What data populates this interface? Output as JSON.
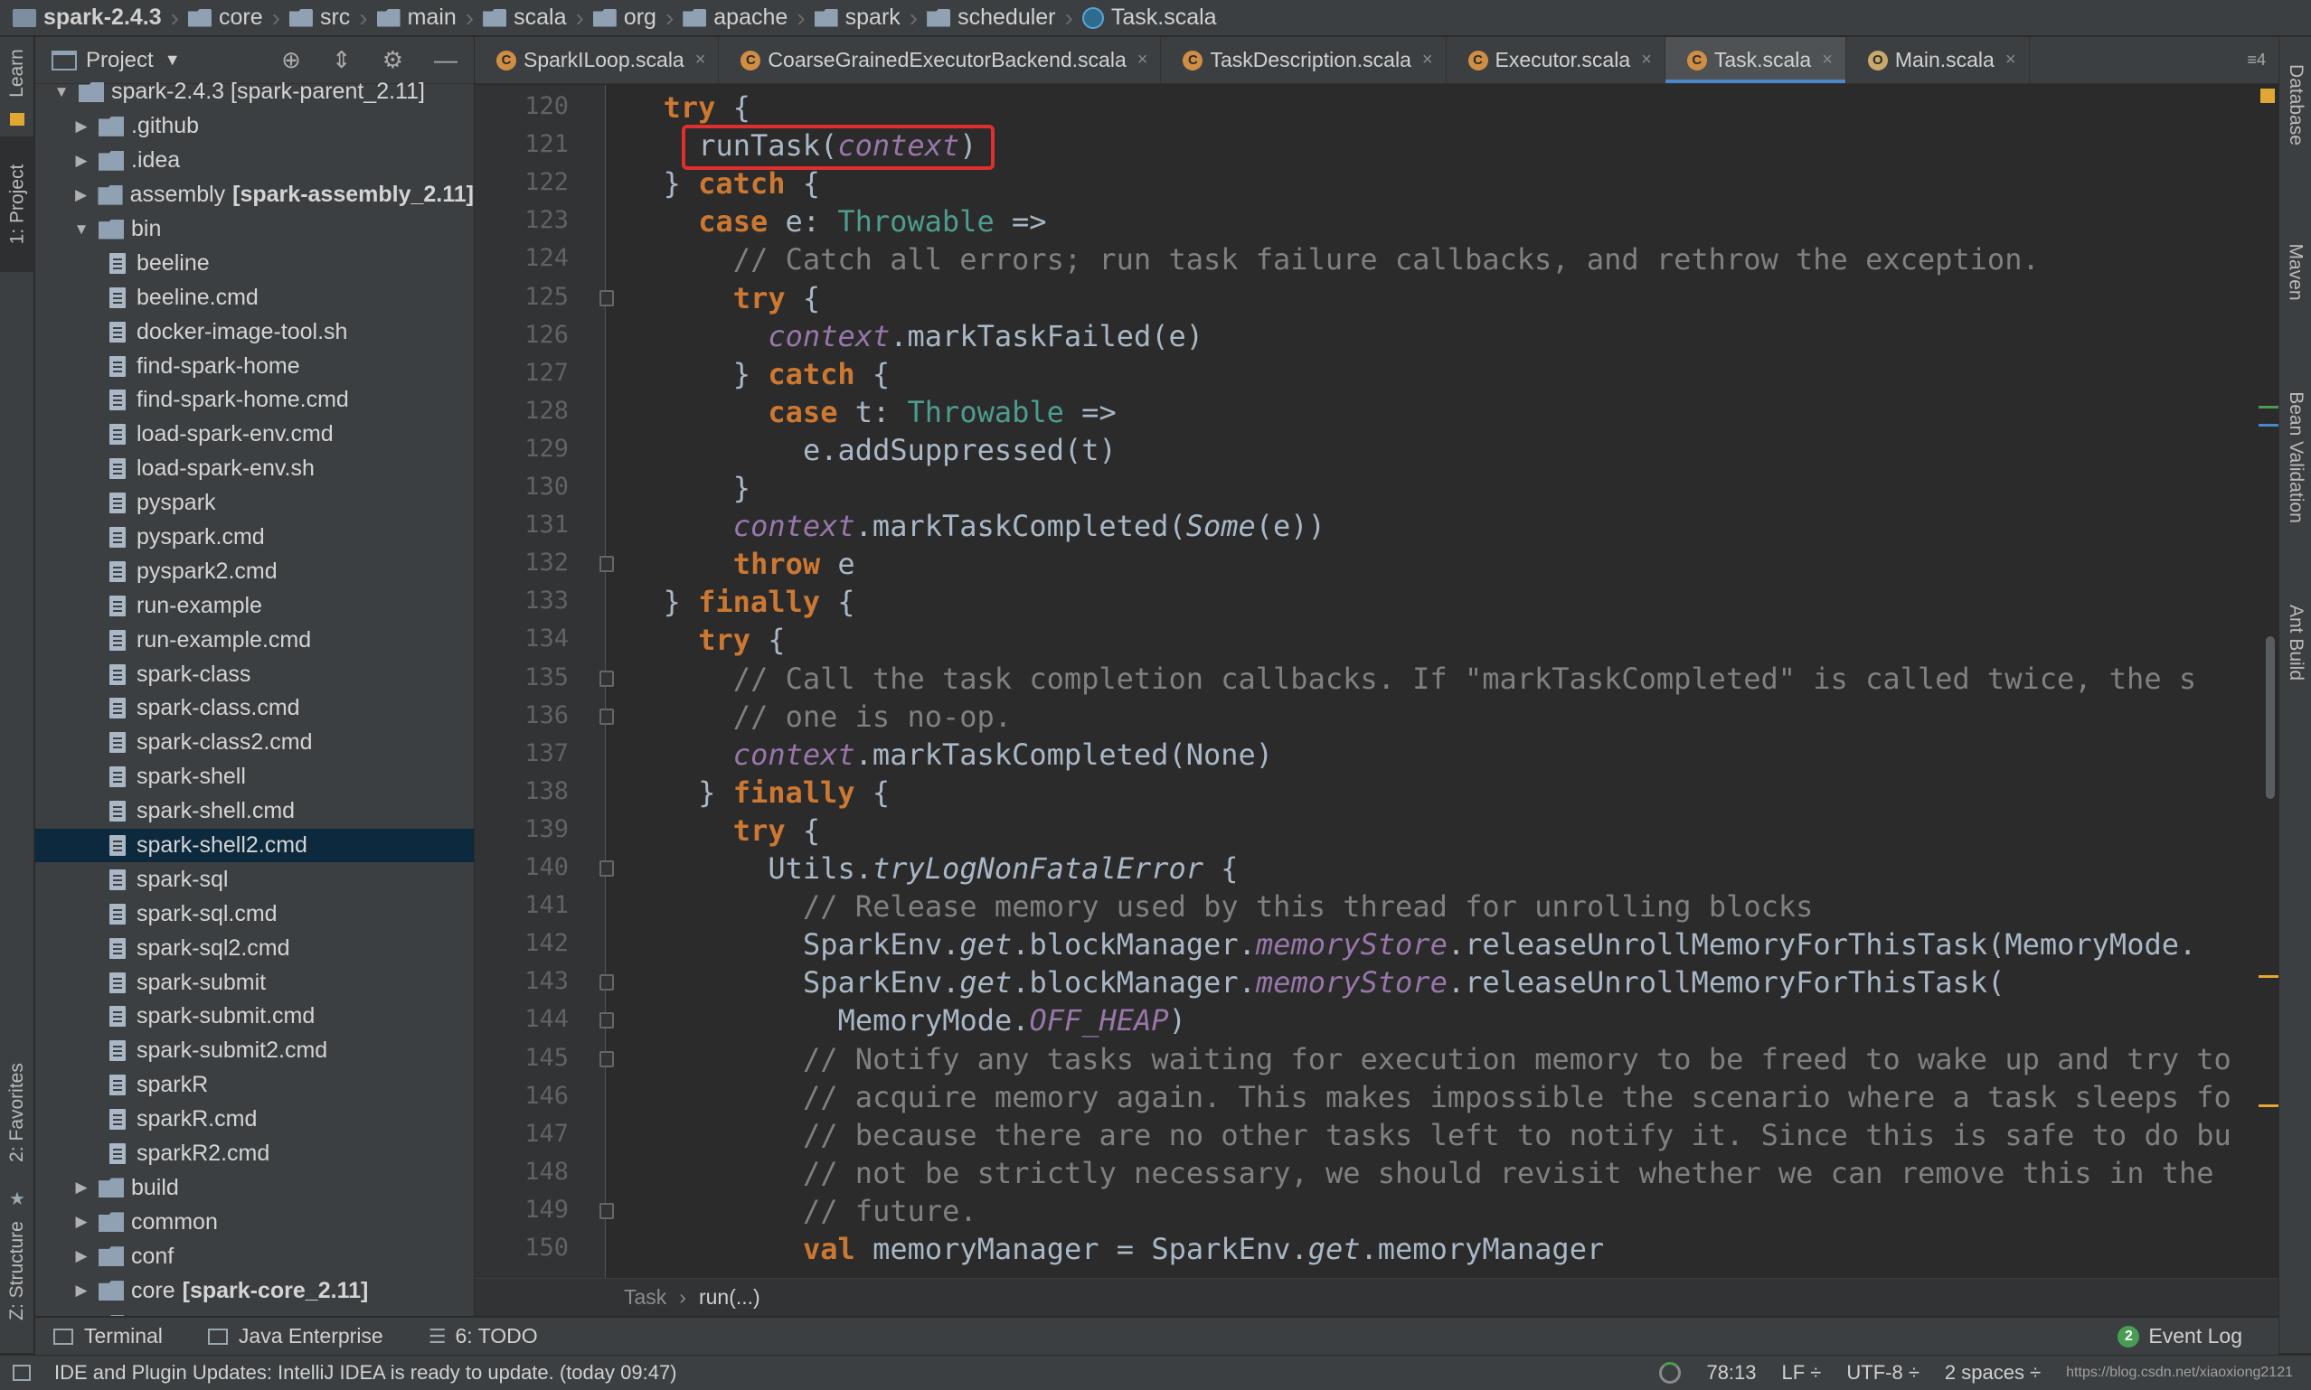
{
  "breadcrumb": [
    {
      "label": "spark-2.4.3",
      "icon": "project-icon"
    },
    {
      "label": "core",
      "icon": "folder-icon"
    },
    {
      "label": "src",
      "icon": "folder-icon"
    },
    {
      "label": "main",
      "icon": "folder-icon"
    },
    {
      "label": "scala",
      "icon": "folder-icon"
    },
    {
      "label": "org",
      "icon": "folder-icon"
    },
    {
      "label": "apache",
      "icon": "folder-icon"
    },
    {
      "label": "spark",
      "icon": "folder-icon"
    },
    {
      "label": "scheduler",
      "icon": "folder-icon"
    },
    {
      "label": "Task.scala",
      "icon": "scala-file-icon"
    }
  ],
  "left_strip": {
    "learn": "Learn",
    "project": "1: Project",
    "favorites": "2: Favorites",
    "structure": "Z: Structure"
  },
  "right_strip": {
    "database": "Database",
    "maven": "Maven",
    "bean": "Bean Validation",
    "ant": "Ant Build"
  },
  "project_panel": {
    "title": "Project",
    "tree": [
      {
        "label": "spark-2.4.3 [spark-parent_2.11]",
        "type": "folder",
        "indent": 0,
        "arrow": "▼",
        "partial": true
      },
      {
        "label": ".github",
        "type": "folder",
        "indent": 1,
        "arrow": "▶"
      },
      {
        "label": ".idea",
        "type": "folder",
        "indent": 1,
        "arrow": "▶"
      },
      {
        "label": "assembly",
        "bold_suffix": "[spark-assembly_2.11]",
        "type": "folder",
        "indent": 1,
        "arrow": "▶"
      },
      {
        "label": "bin",
        "type": "folder",
        "indent": 1,
        "arrow": "▼"
      },
      {
        "label": "beeline",
        "type": "file",
        "indent": 2
      },
      {
        "label": "beeline.cmd",
        "type": "file",
        "indent": 2
      },
      {
        "label": "docker-image-tool.sh",
        "type": "file",
        "indent": 2
      },
      {
        "label": "find-spark-home",
        "type": "file",
        "indent": 2
      },
      {
        "label": "find-spark-home.cmd",
        "type": "file",
        "indent": 2
      },
      {
        "label": "load-spark-env.cmd",
        "type": "file",
        "indent": 2
      },
      {
        "label": "load-spark-env.sh",
        "type": "file",
        "indent": 2
      },
      {
        "label": "pyspark",
        "type": "file",
        "indent": 2
      },
      {
        "label": "pyspark.cmd",
        "type": "file",
        "indent": 2
      },
      {
        "label": "pyspark2.cmd",
        "type": "file",
        "indent": 2
      },
      {
        "label": "run-example",
        "type": "file",
        "indent": 2
      },
      {
        "label": "run-example.cmd",
        "type": "file",
        "indent": 2
      },
      {
        "label": "spark-class",
        "type": "file",
        "indent": 2
      },
      {
        "label": "spark-class.cmd",
        "type": "file",
        "indent": 2
      },
      {
        "label": "spark-class2.cmd",
        "type": "file",
        "indent": 2
      },
      {
        "label": "spark-shell",
        "type": "file",
        "indent": 2
      },
      {
        "label": "spark-shell.cmd",
        "type": "file",
        "indent": 2
      },
      {
        "label": "spark-shell2.cmd",
        "type": "file",
        "indent": 2,
        "selected": true
      },
      {
        "label": "spark-sql",
        "type": "file",
        "indent": 2
      },
      {
        "label": "spark-sql.cmd",
        "type": "file",
        "indent": 2
      },
      {
        "label": "spark-sql2.cmd",
        "type": "file",
        "indent": 2
      },
      {
        "label": "spark-submit",
        "type": "file",
        "indent": 2
      },
      {
        "label": "spark-submit.cmd",
        "type": "file",
        "indent": 2
      },
      {
        "label": "spark-submit2.cmd",
        "type": "file",
        "indent": 2
      },
      {
        "label": "sparkR",
        "type": "file",
        "indent": 2
      },
      {
        "label": "sparkR.cmd",
        "type": "file",
        "indent": 2
      },
      {
        "label": "sparkR2.cmd",
        "type": "file",
        "indent": 2
      },
      {
        "label": "build",
        "type": "folder",
        "indent": 1,
        "arrow": "▶"
      },
      {
        "label": "common",
        "type": "folder",
        "indent": 1,
        "arrow": "▶"
      },
      {
        "label": "conf",
        "type": "folder",
        "indent": 1,
        "arrow": "▶"
      },
      {
        "label": "core",
        "bold_suffix": "[spark-core_2.11]",
        "type": "folder",
        "indent": 1,
        "arrow": "▶"
      },
      {
        "label": "data",
        "type": "folder",
        "indent": 1,
        "arrow": "▶",
        "partial": true
      }
    ]
  },
  "tabs": [
    {
      "label": "SparkILoop.scala",
      "icon": "C",
      "active": false
    },
    {
      "label": "CoarseGrainedExecutorBackend.scala",
      "icon": "C",
      "active": false
    },
    {
      "label": "TaskDescription.scala",
      "icon": "C",
      "active": false
    },
    {
      "label": "Executor.scala",
      "icon": "C",
      "active": false
    },
    {
      "label": "Task.scala",
      "icon": "C",
      "active": true
    },
    {
      "label": "Main.scala",
      "icon": "O",
      "active": false
    }
  ],
  "tabs_more": "≡4",
  "editor": {
    "first_partial_line": "119",
    "lines": [
      {
        "n": "120",
        "indent": 2,
        "tokens": [
          [
            "kw",
            "try"
          ],
          [
            "p",
            " {"
          ]
        ]
      },
      {
        "n": "121",
        "indent": 3,
        "tokens": [
          [
            "p",
            "runTask("
          ],
          [
            "ctx",
            "context"
          ],
          [
            "p",
            ")"
          ]
        ],
        "highlight": true
      },
      {
        "n": "122",
        "indent": 2,
        "tokens": [
          [
            "p",
            "} "
          ],
          [
            "kw",
            "catch"
          ],
          [
            "p",
            " {"
          ]
        ]
      },
      {
        "n": "123",
        "indent": 3,
        "tokens": [
          [
            "kw",
            "case"
          ],
          [
            "p",
            " e: "
          ],
          [
            "ty",
            "Throwable"
          ],
          [
            "p",
            " =>"
          ]
        ]
      },
      {
        "n": "124",
        "indent": 4,
        "tokens": [
          [
            "cm",
            "// Catch all errors; run task failure callbacks, and rethrow the exception."
          ]
        ]
      },
      {
        "n": "125",
        "indent": 4,
        "tokens": [
          [
            "kw",
            "try"
          ],
          [
            "p",
            " {"
          ]
        ],
        "fold": true
      },
      {
        "n": "126",
        "indent": 5,
        "tokens": [
          [
            "ctx",
            "context"
          ],
          [
            "p",
            ".markTaskFailed(e)"
          ]
        ]
      },
      {
        "n": "127",
        "indent": 4,
        "tokens": [
          [
            "p",
            "} "
          ],
          [
            "kw",
            "catch"
          ],
          [
            "p",
            " {"
          ]
        ]
      },
      {
        "n": "128",
        "indent": 5,
        "tokens": [
          [
            "kw",
            "case"
          ],
          [
            "p",
            " t: "
          ],
          [
            "ty",
            "Throwable"
          ],
          [
            "p",
            " =>"
          ]
        ]
      },
      {
        "n": "129",
        "indent": 6,
        "tokens": [
          [
            "p",
            "e.addSuppressed(t)"
          ]
        ]
      },
      {
        "n": "130",
        "indent": 4,
        "tokens": [
          [
            "p",
            "}"
          ]
        ]
      },
      {
        "n": "131",
        "indent": 4,
        "tokens": [
          [
            "ctx",
            "context"
          ],
          [
            "p",
            ".markTaskCompleted("
          ],
          [
            "it",
            "Some"
          ],
          [
            "p",
            "(e))"
          ]
        ]
      },
      {
        "n": "132",
        "indent": 4,
        "tokens": [
          [
            "kw",
            "throw"
          ],
          [
            "p",
            " e"
          ]
        ],
        "fold": true
      },
      {
        "n": "133",
        "indent": 2,
        "tokens": [
          [
            "p",
            "} "
          ],
          [
            "kw",
            "finally"
          ],
          [
            "p",
            " {"
          ]
        ]
      },
      {
        "n": "134",
        "indent": 3,
        "tokens": [
          [
            "kw",
            "try"
          ],
          [
            "p",
            " {"
          ]
        ]
      },
      {
        "n": "135",
        "indent": 4,
        "tokens": [
          [
            "cm",
            "// Call the task completion callbacks. If \"markTaskCompleted\" is called twice, the s"
          ]
        ],
        "fold": true
      },
      {
        "n": "136",
        "indent": 4,
        "tokens": [
          [
            "cm",
            "// one is no-op."
          ]
        ],
        "fold": true
      },
      {
        "n": "137",
        "indent": 4,
        "tokens": [
          [
            "ctx",
            "context"
          ],
          [
            "p",
            ".markTaskCompleted(None)"
          ]
        ]
      },
      {
        "n": "138",
        "indent": 3,
        "tokens": [
          [
            "p",
            "} "
          ],
          [
            "kw",
            "finally"
          ],
          [
            "p",
            " {"
          ]
        ]
      },
      {
        "n": "139",
        "indent": 4,
        "tokens": [
          [
            "kw",
            "try"
          ],
          [
            "p",
            " {"
          ]
        ]
      },
      {
        "n": "140",
        "indent": 5,
        "tokens": [
          [
            "p",
            "Utils."
          ],
          [
            "it",
            "tryLogNonFatalError"
          ],
          [
            "p",
            " {"
          ]
        ],
        "fold": true
      },
      {
        "n": "141",
        "indent": 6,
        "tokens": [
          [
            "cm",
            "// Release memory used by this thread for unrolling blocks"
          ]
        ]
      },
      {
        "n": "142",
        "indent": 6,
        "tokens": [
          [
            "p",
            "SparkEnv."
          ],
          [
            "it",
            "get"
          ],
          [
            "p",
            ".blockManager."
          ],
          [
            "st",
            "memoryStore"
          ],
          [
            "p",
            ".releaseUnrollMemoryForThisTask(MemoryMode."
          ]
        ]
      },
      {
        "n": "143",
        "indent": 6,
        "tokens": [
          [
            "p",
            "SparkEnv."
          ],
          [
            "it",
            "get"
          ],
          [
            "p",
            ".blockManager."
          ],
          [
            "st",
            "memoryStore"
          ],
          [
            "p",
            ".releaseUnrollMemoryForThisTask("
          ]
        ],
        "fold": true
      },
      {
        "n": "144",
        "indent": 7,
        "tokens": [
          [
            "p",
            "MemoryMode."
          ],
          [
            "st",
            "OFF_HEAP"
          ],
          [
            "p",
            ")"
          ]
        ],
        "fold": true
      },
      {
        "n": "145",
        "indent": 6,
        "tokens": [
          [
            "cm",
            "// Notify any tasks waiting for execution memory to be freed to wake up and try to"
          ]
        ],
        "fold": true
      },
      {
        "n": "146",
        "indent": 6,
        "tokens": [
          [
            "cm",
            "// acquire memory again. This makes impossible the scenario where a task sleeps fo"
          ]
        ]
      },
      {
        "n": "147",
        "indent": 6,
        "tokens": [
          [
            "cm",
            "// because there are no other tasks left to notify it. Since this is safe to do bu"
          ]
        ]
      },
      {
        "n": "148",
        "indent": 6,
        "tokens": [
          [
            "cm",
            "// not be strictly necessary, we should revisit whether we can remove this in the"
          ]
        ]
      },
      {
        "n": "149",
        "indent": 6,
        "tokens": [
          [
            "cm",
            "// future."
          ]
        ],
        "fold": true
      },
      {
        "n": "150",
        "indent": 6,
        "tokens": [
          [
            "kw",
            "val"
          ],
          [
            "p",
            " memoryManager = SparkEnv."
          ],
          [
            "it",
            "get"
          ],
          [
            "p",
            ".memoryManager"
          ]
        ]
      }
    ]
  },
  "editor_breadcrumb": {
    "parent": "Task",
    "current": "run(...)"
  },
  "toolwindows": [
    {
      "label": "Terminal",
      "icon": "terminal-icon"
    },
    {
      "label": "Java Enterprise",
      "icon": "java-enterprise-icon"
    },
    {
      "label": "6: TODO",
      "icon": "todo-icon"
    }
  ],
  "event_log": {
    "count": "2",
    "label": "Event Log"
  },
  "status": {
    "message": "IDE and Plugin Updates: IntelliJ IDEA is ready to update. (today 09:47)",
    "position": "78:13",
    "line_sep": "LF ÷",
    "encoding": "UTF-8 ÷",
    "indent": "2 spaces ÷",
    "watermark": "https://blog.csdn.net/xiaoxiong2121"
  },
  "colors": {
    "accent": "#4a88c7",
    "keyword": "#cc7832",
    "comment": "#808080",
    "highlight_box": "#e0302e",
    "selection": "#0d293e"
  }
}
